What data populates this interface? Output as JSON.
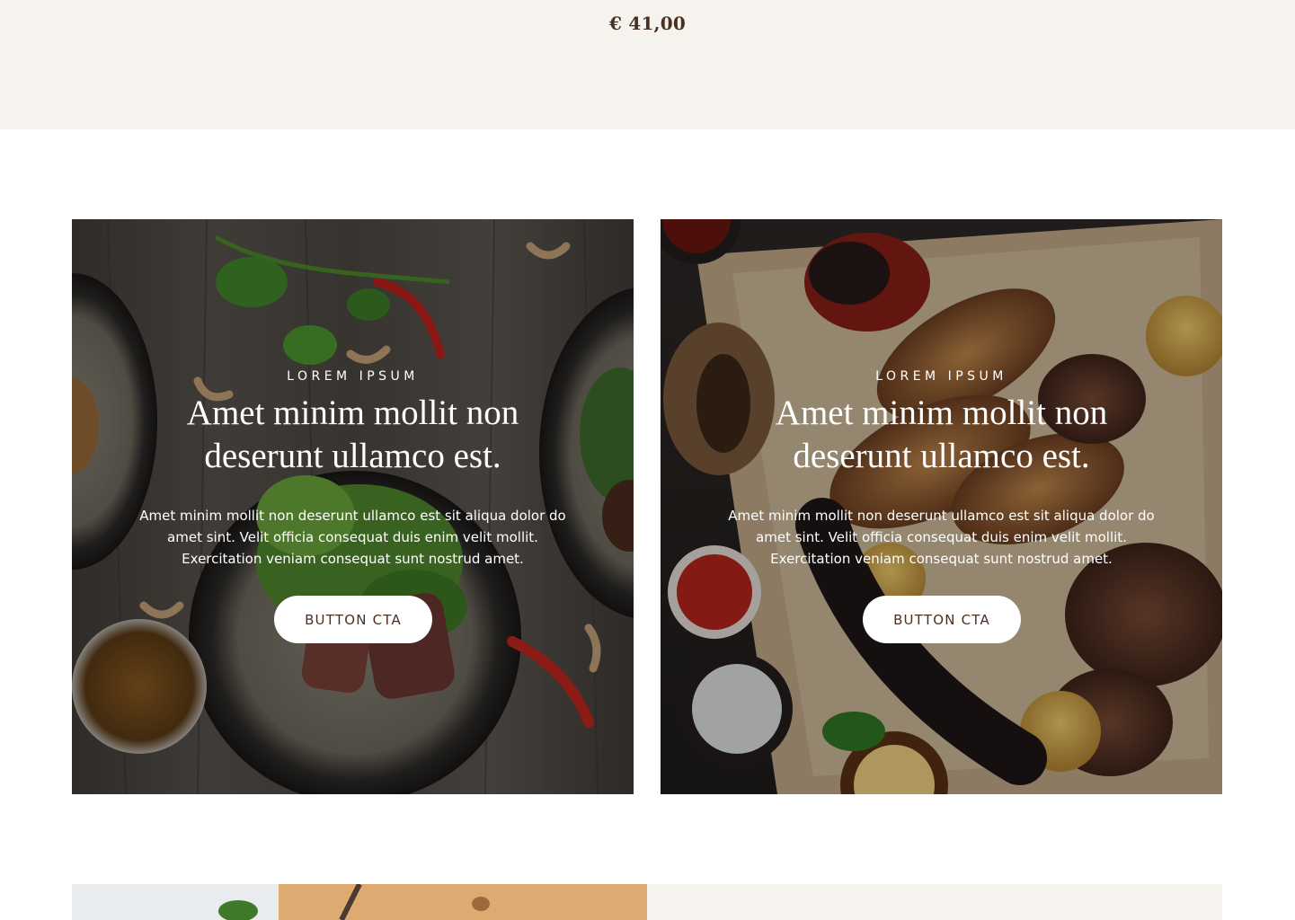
{
  "product": {
    "price": "€ 41,00"
  },
  "cards": [
    {
      "eyebrow": "LOREM IPSUM",
      "title": "Amet minim mollit non deserunt ullamco est.",
      "body": "Amet minim mollit non deserunt ullamco est sit aliqua dolor do amet sint. Velit officia consequat duis enim velit mollit. Exercitation veniam consequat sunt nostrud amet.",
      "cta_label": "BUTTON CTA"
    },
    {
      "eyebrow": "LOREM IPSUM",
      "title": "Amet minim mollit non deserunt ullamco est.",
      "body": "Amet minim mollit non deserunt ullamco est sit aliqua dolor do amet sint. Velit officia consequat duis enim velit mollit. Exercitation veniam consequat sunt nostrud amet.",
      "cta_label": "BUTTON CTA"
    }
  ],
  "colors": {
    "accent_text": "#4a3023",
    "cream_background": "#f6f2ed"
  }
}
